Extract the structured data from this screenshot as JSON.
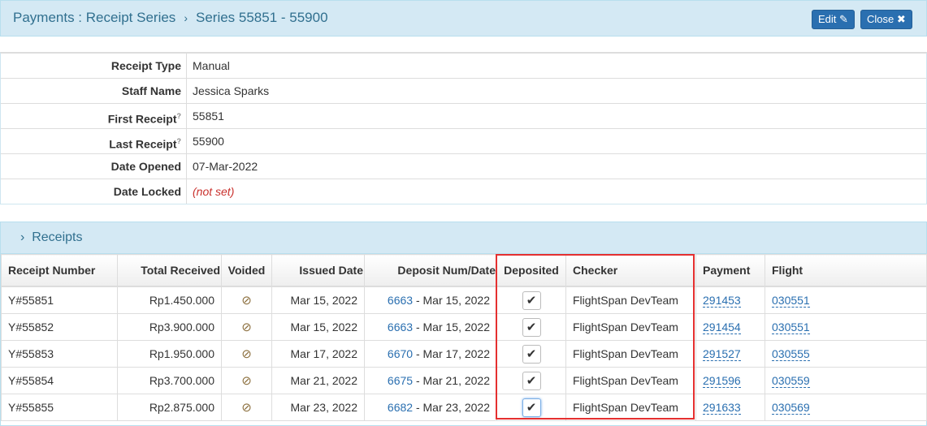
{
  "header": {
    "breadcrumb_root": "Payments : Receipt Series",
    "breadcrumb_sep": "›",
    "breadcrumb_current": "Series 55851 - 55900",
    "edit_label": "Edit ✎",
    "close_label": "Close ✖"
  },
  "details": [
    {
      "label": "Receipt Type",
      "value": "Manual"
    },
    {
      "label": "Staff Name",
      "value": "Jessica Sparks"
    },
    {
      "label": "First Receipt",
      "value": "55851",
      "help": "?"
    },
    {
      "label": "Last Receipt",
      "value": "55900",
      "help": "?"
    },
    {
      "label": "Date Opened",
      "value": "07-Mar-2022"
    },
    {
      "label": "Date Locked",
      "value": "(not set)"
    }
  ],
  "receipts": {
    "title": "Receipts",
    "toggle": "›",
    "columns": [
      "Receipt Number",
      "Total Received",
      "Voided",
      "Issued Date",
      "Deposit Num/Date",
      "Deposited",
      "Checker",
      "Payment",
      "Flight"
    ],
    "rows": [
      {
        "num": "Y#55851",
        "total": "Rp1.450.000",
        "issued": "Mar 15, 2022",
        "dep_num": "6663",
        "dep_date": " - Mar 15, 2022",
        "checker": "FlightSpan DevTeam",
        "payment": "291453",
        "flight": "030551"
      },
      {
        "num": "Y#55852",
        "total": "Rp3.900.000",
        "issued": "Mar 15, 2022",
        "dep_num": "6663",
        "dep_date": " - Mar 15, 2022",
        "checker": "FlightSpan DevTeam",
        "payment": "291454",
        "flight": "030551"
      },
      {
        "num": "Y#55853",
        "total": "Rp1.950.000",
        "issued": "Mar 17, 2022",
        "dep_num": "6670",
        "dep_date": " - Mar 17, 2022",
        "checker": "FlightSpan DevTeam",
        "payment": "291527",
        "flight": "030555"
      },
      {
        "num": "Y#55854",
        "total": "Rp3.700.000",
        "issued": "Mar 21, 2022",
        "dep_num": "6675",
        "dep_date": " - Mar 21, 2022",
        "checker": "FlightSpan DevTeam",
        "payment": "291596",
        "flight": "030559"
      },
      {
        "num": "Y#55855",
        "total": "Rp2.875.000",
        "issued": "Mar 23, 2022",
        "dep_num": "6682",
        "dep_date": " - Mar 23, 2022",
        "checker": "FlightSpan DevTeam",
        "payment": "291633",
        "flight": "030569"
      }
    ]
  },
  "icons": {
    "voided": "⊘",
    "check": "✔"
  }
}
